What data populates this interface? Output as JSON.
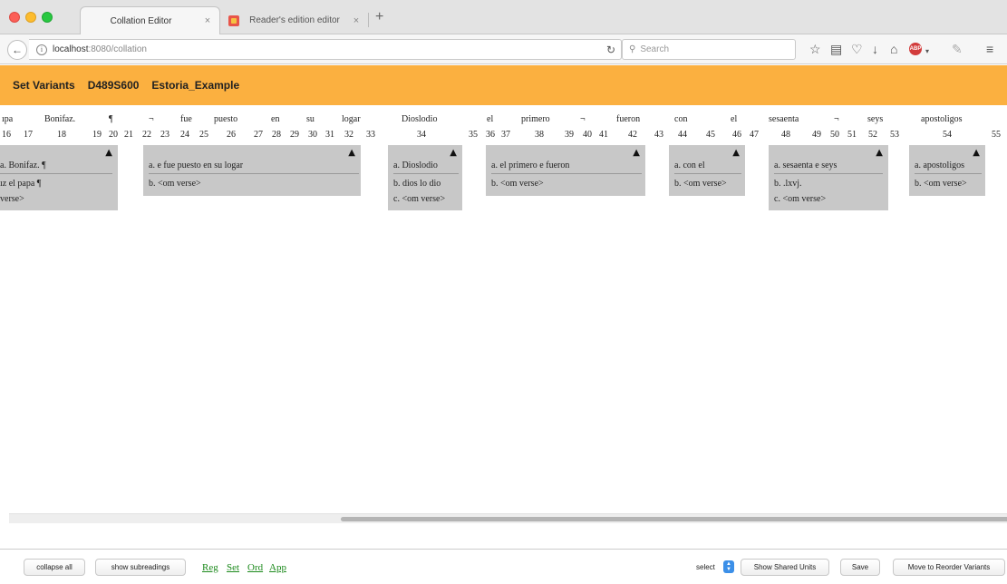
{
  "browser": {
    "tabs": [
      {
        "title": "Collation Editor",
        "active": true
      },
      {
        "title": "Reader's edition editor",
        "active": false
      }
    ],
    "url_host": "localhost",
    "url_path": ":8080/collation",
    "search_placeholder": "Search"
  },
  "header": {
    "title": "Set Variants",
    "id": "D489S600",
    "project": "Estoria_Example"
  },
  "collation": {
    "words": [
      "ıpa",
      "Bonifaz.",
      "¶",
      "¬",
      "fue",
      "puesto",
      "en",
      "su",
      "logar",
      "Dioslodio",
      "el",
      "primero",
      "¬",
      "fueron",
      "con",
      "el",
      "sesaenta",
      "¬",
      "seys",
      "apostoligos"
    ],
    "numbers": [
      "16",
      "17",
      "18",
      "19",
      "20",
      "21",
      "22",
      "23",
      "24",
      "25",
      "26",
      "27",
      "28",
      "29",
      "30",
      "31",
      "32",
      "33",
      "34",
      "35",
      "36",
      "37",
      "38",
      "39",
      "40",
      "41",
      "42",
      "43",
      "44",
      "45",
      "46",
      "47",
      "48",
      "49",
      "50",
      "51",
      "52",
      "53",
      "54",
      "55"
    ],
    "units": [
      {
        "readings": [
          "a. Bonifaz. ¶",
          "ız el papa ¶",
          "verse>"
        ]
      },
      {
        "readings": [
          "a. e fue puesto en su logar",
          "b. <om verse>"
        ]
      },
      {
        "readings": [
          "a. Dioslodio",
          "b. dios lo dio",
          "c. <om verse>"
        ]
      },
      {
        "readings": [
          "a. el primero e fueron",
          "b. <om verse>"
        ]
      },
      {
        "readings": [
          "a. con el",
          "b. <om verse>"
        ]
      },
      {
        "readings": [
          "a. sesaenta e seys",
          "b. .lxvj.",
          "c. <om verse>"
        ]
      },
      {
        "readings": [
          "a. apostoligos",
          "b. <om verse>"
        ]
      }
    ],
    "expand_glyph": "▲"
  },
  "footer": {
    "collapse_all": "collapse all",
    "show_subreadings": "show subreadings",
    "links": [
      "Reg",
      "Set",
      "Ord",
      "App"
    ],
    "select_label": "select",
    "show_shared_units": "Show Shared Units",
    "save": "Save",
    "move_to_reorder": "Move to Reorder Variants"
  }
}
